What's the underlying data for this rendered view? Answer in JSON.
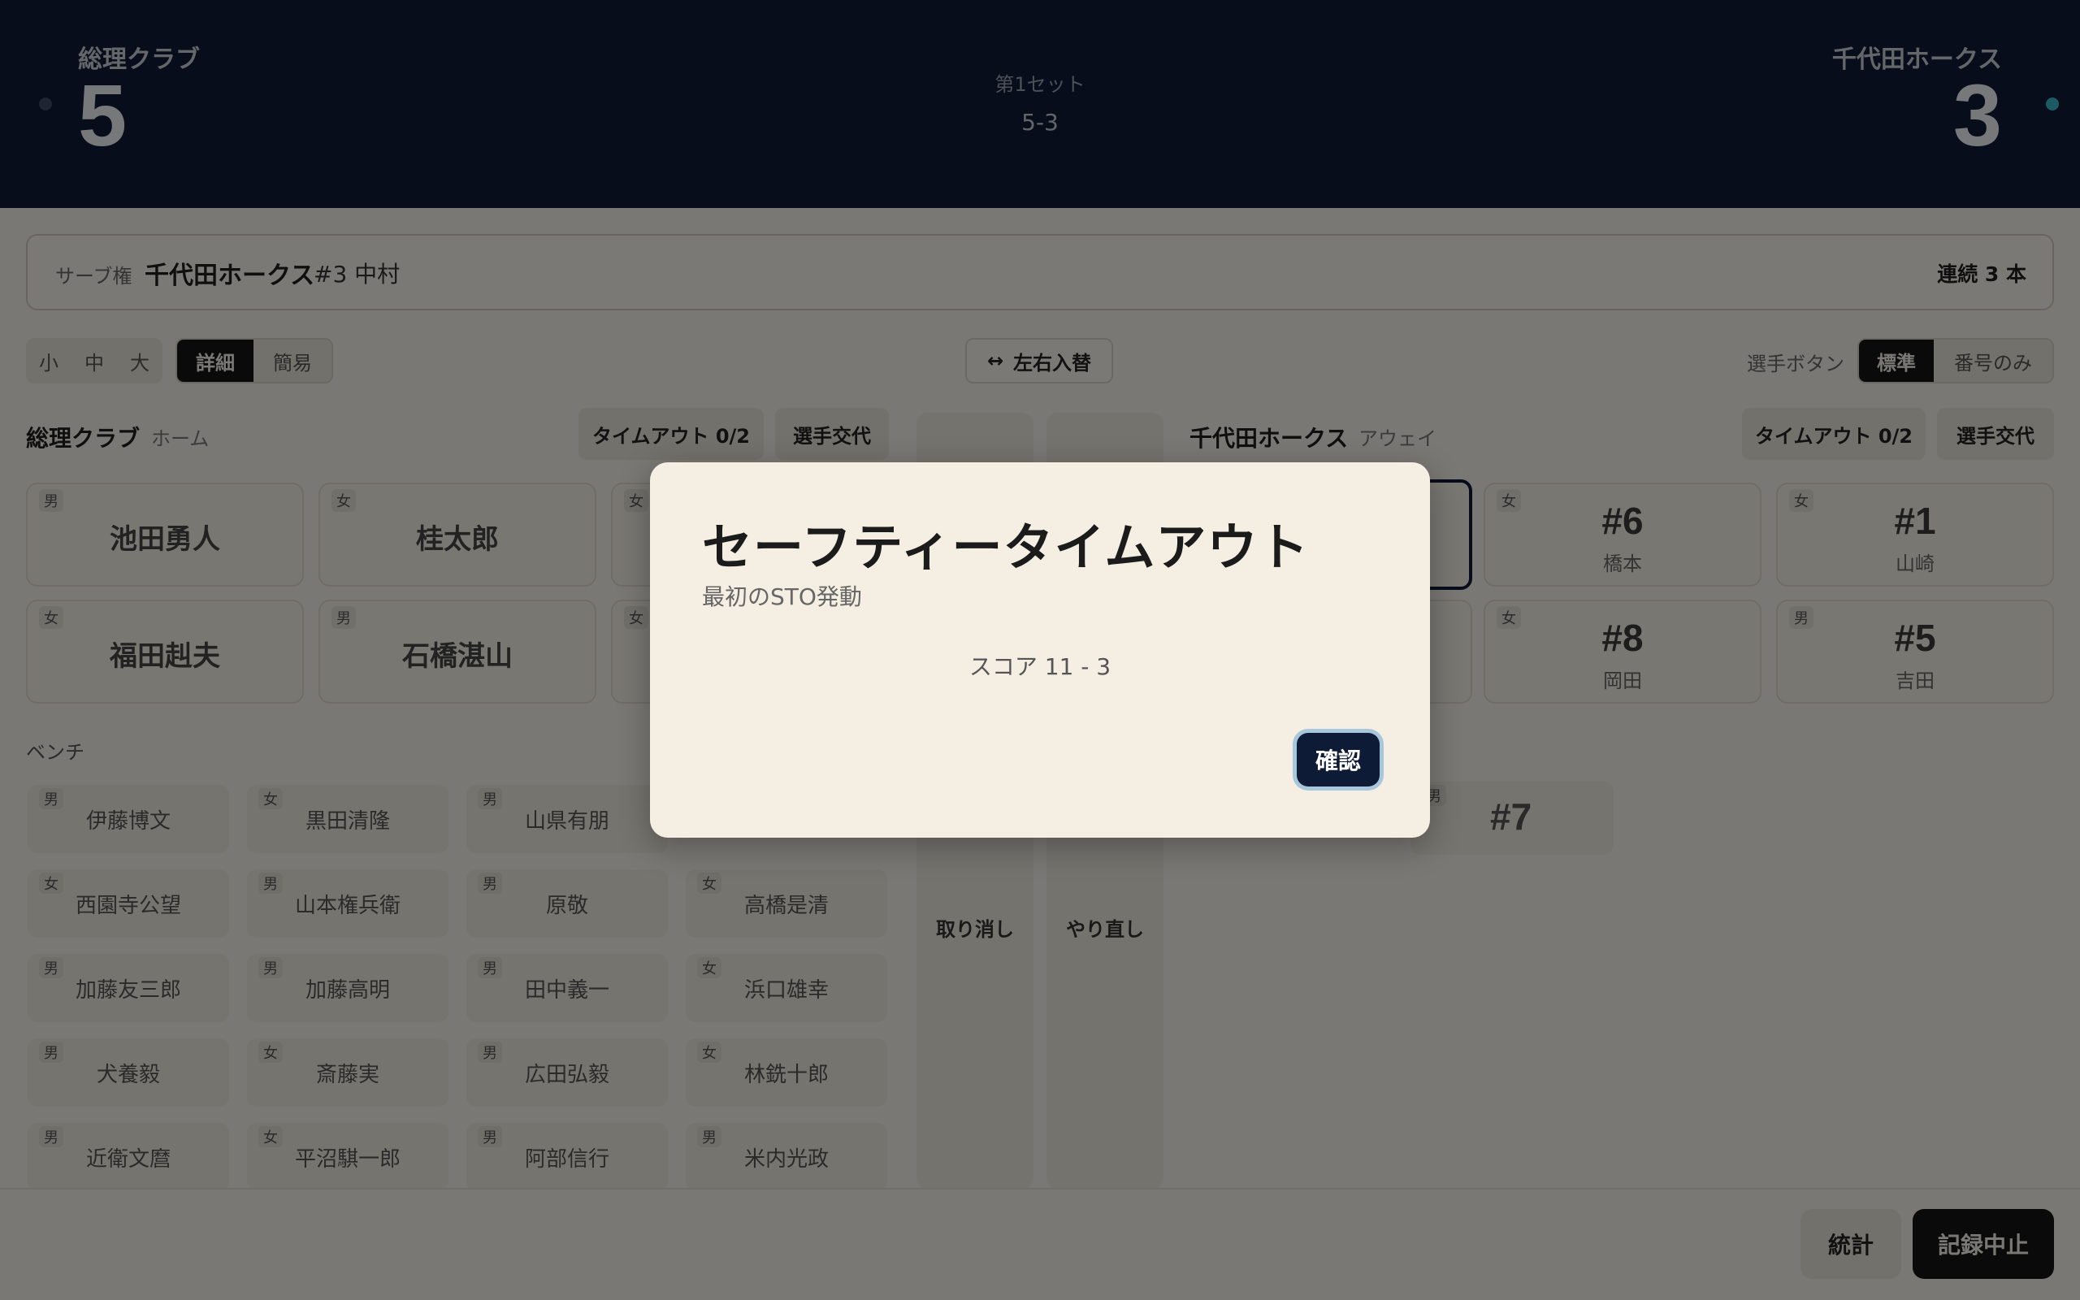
{
  "header": {
    "home_name": "総理クラブ",
    "home_score": "5",
    "away_name": "千代田ホークス",
    "away_score": "3",
    "set_label": "第1セット",
    "set_score": "5-3"
  },
  "serve": {
    "label": "サーブ権",
    "team": "千代田ホークス",
    "player": "#3 中村",
    "streak": "連続 3 本"
  },
  "toolbar": {
    "sizes": [
      "小",
      "中",
      "大"
    ],
    "detail": "詳細",
    "simple": "簡易",
    "swap": "左右入替",
    "player_button_label": "選手ボタン",
    "standard": "標準",
    "number_only": "番号のみ"
  },
  "home": {
    "name": "総理クラブ",
    "side": "ホーム",
    "timeout": "タイムアウト 0/2",
    "substitution": "選手交代",
    "court": [
      {
        "gender": "男",
        "name": "池田勇人"
      },
      {
        "gender": "女",
        "name": "桂太郎"
      },
      {
        "gender": "女",
        "name": ""
      },
      {
        "gender": "女",
        "name": "福田赳夫"
      },
      {
        "gender": "男",
        "name": "石橋湛山"
      },
      {
        "gender": "女",
        "name": ""
      }
    ],
    "bench_label": "ベンチ",
    "bench": [
      {
        "gender": "男",
        "name": "伊藤博文"
      },
      {
        "gender": "女",
        "name": "黒田清隆"
      },
      {
        "gender": "男",
        "name": "山県有朋"
      },
      {
        "gender": "女",
        "name": "西園寺公望"
      },
      {
        "gender": "男",
        "name": "山本権兵衛"
      },
      {
        "gender": "男",
        "name": "原敬"
      },
      {
        "gender": "女",
        "name": "高橋是清"
      },
      {
        "gender": "男",
        "name": "加藤友三郎"
      },
      {
        "gender": "男",
        "name": "加藤高明"
      },
      {
        "gender": "男",
        "name": "田中義一"
      },
      {
        "gender": "女",
        "name": "浜口雄幸"
      },
      {
        "gender": "男",
        "name": "犬養毅"
      },
      {
        "gender": "女",
        "name": "斎藤実"
      },
      {
        "gender": "男",
        "name": "広田弘毅"
      },
      {
        "gender": "女",
        "name": "林銑十郎"
      },
      {
        "gender": "男",
        "name": "近衛文麿"
      },
      {
        "gender": "女",
        "name": "平沼騏一郎"
      },
      {
        "gender": "男",
        "name": "阿部信行"
      },
      {
        "gender": "男",
        "name": "米内光政"
      }
    ]
  },
  "away": {
    "name": "千代田ホークス",
    "side": "アウェイ",
    "timeout": "タイムアウト 0/2",
    "substitution": "選手交代",
    "court": [
      {
        "gender": "女",
        "number": "#6",
        "name": "橋本"
      },
      {
        "gender": "女",
        "number": "#1",
        "name": "山崎"
      },
      {
        "gender": "女",
        "number": "#8",
        "name": "岡田"
      },
      {
        "gender": "男",
        "number": "#5",
        "name": "吉田"
      }
    ],
    "bench": [
      {
        "gender": "男",
        "number": "#7"
      }
    ]
  },
  "controls": {
    "undo": "取り消し",
    "redo": "やり直し"
  },
  "footer": {
    "stats": "統計",
    "stop": "記録中止"
  },
  "modal": {
    "title": "セーフティータイムアウト",
    "subtitle": "最初のSTO発動",
    "score": "スコア 11 - 3",
    "confirm": "確認"
  }
}
